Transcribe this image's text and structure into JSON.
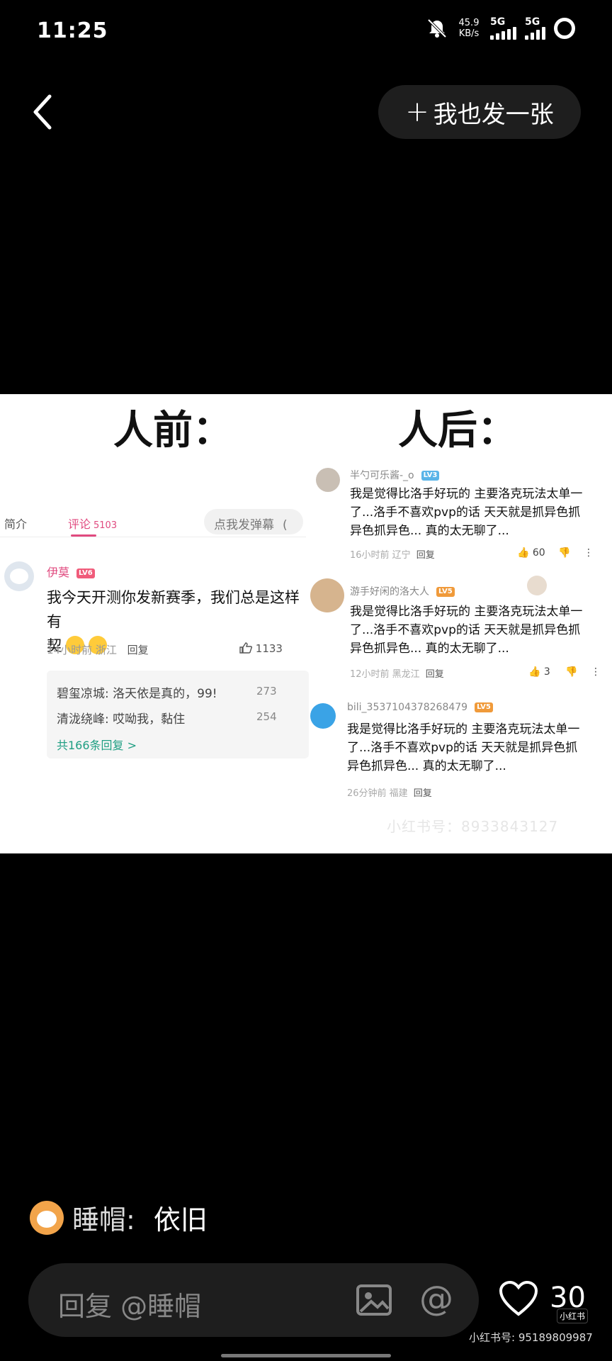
{
  "status_bar": {
    "time": "11:25",
    "speed_value": "45.9",
    "speed_unit": "KB/s",
    "sim1": "5G",
    "sim2": "5G"
  },
  "header": {
    "publish_label": "我也发一张"
  },
  "post_image": {
    "left_heading": "人前：",
    "right_heading": "人后：",
    "left": {
      "tabs": {
        "intro": "简介",
        "comments": "评论",
        "comments_count": "5103",
        "danmaku": "点我发弹幕",
        "bracket": "("
      },
      "comment": {
        "username": "伊莫",
        "level": "LV6",
        "text": "我今天开测你发新赛季，我们总是这样有",
        "text2": "契",
        "time_location": "14小时前 浙江",
        "reply": "回复",
        "likes": "1133"
      },
      "replies": [
        {
          "text": "碧玺凉城: 洛天依是真的，99!",
          "likes": "273"
        },
        {
          "text": "清泷绕峰: 哎呦我，黏住",
          "likes": "254"
        }
      ],
      "more_replies": "共166条回复 >"
    },
    "right": {
      "comments": [
        {
          "username": "半勺可乐酱-_o",
          "level": "LV3",
          "line1": "我是觉得比洛手好玩的 主要洛克玩法太单一",
          "line2": "了...洛手不喜欢pvp的话 天天就是抓异色抓",
          "line3": "异色抓异色... 真的太无聊了...",
          "time_location": "16小时前 辽宁",
          "reply": "回复",
          "likes": "60"
        },
        {
          "username": "游手好闲的洛大人",
          "level": "LV5",
          "line1": "我是觉得比洛手好玩的 主要洛克玩法太单一",
          "line2": "了...洛手不喜欢pvp的话 天天就是抓异色抓",
          "line3": "异色抓异色... 真的太无聊了...",
          "time_location": "12小时前 黑龙江",
          "reply": "回复",
          "likes": "3"
        },
        {
          "username": "bili_3537104378268479",
          "level": "LV5",
          "line1": "我是觉得比洛手好玩的 主要洛克玩法太单一",
          "line2": "了...洛手不喜欢pvp的话 天天就是抓异色抓",
          "line3": "异色抓异色... 真的太无聊了...",
          "time_location": "26分钟前 福建",
          "reply": "回复",
          "likes": ""
        }
      ],
      "watermark": "小红书号：8933843127"
    }
  },
  "caption": {
    "author": "睡帽:",
    "text": "依旧"
  },
  "bottom_bar": {
    "reply_placeholder": "回复 @睡帽",
    "like_count": "30",
    "brand": "小红书",
    "id_text": "小红书号: 95189809987"
  }
}
